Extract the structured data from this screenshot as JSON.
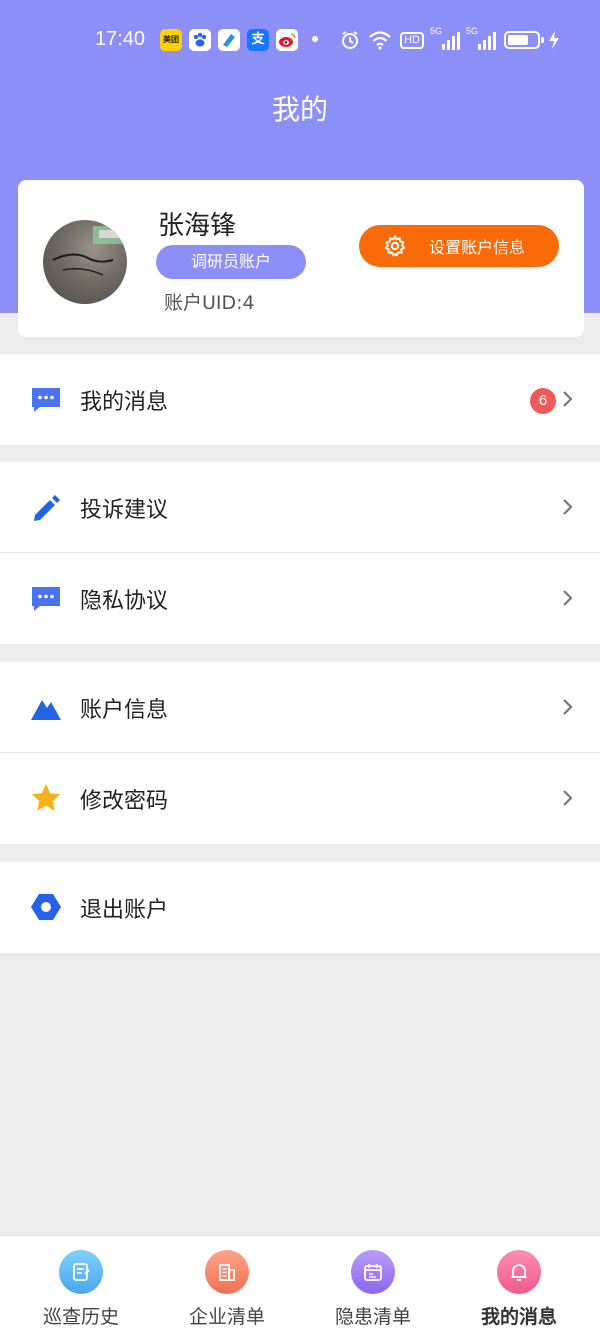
{
  "status_bar": {
    "time": "17:40",
    "app_icons": [
      "美团",
      "baidu-paw-icon",
      "app-icon",
      "支",
      "weibo-icon"
    ],
    "hd": "HD",
    "signal_1": "5G",
    "signal_2": "5G"
  },
  "header": {
    "title": "我的"
  },
  "profile": {
    "name": "张海锋",
    "role": "调研员账户",
    "uid": "账户UID:4",
    "settings_button": "设置账户信息"
  },
  "menu": [
    {
      "label": "我的消息",
      "icon": "message-icon",
      "badge": "6",
      "color": "#4a73f0"
    },
    {
      "label": "投诉建议",
      "icon": "pencil-icon",
      "color": "#2563e6"
    },
    {
      "label": "隐私协议",
      "icon": "message-icon",
      "color": "#4a73f0"
    },
    {
      "label": "账户信息",
      "icon": "mountain-icon",
      "color": "#2563e6"
    },
    {
      "label": "修改密码",
      "icon": "star-icon",
      "color": "#f6b21a"
    },
    {
      "label": "退出账户",
      "icon": "hexagon-icon",
      "color": "#2563e6"
    }
  ],
  "tabbar": [
    {
      "label": "巡查历史",
      "icon": "history-icon",
      "color": "#57b6f3"
    },
    {
      "label": "企业清单",
      "icon": "building-icon",
      "color": "#f2886a"
    },
    {
      "label": "隐患清单",
      "icon": "calendar-icon",
      "color": "#9a7bf0"
    },
    {
      "label": "我的消息",
      "icon": "bell-icon",
      "color": "#f56a9a",
      "active": true
    }
  ],
  "colors": {
    "header": "#8b8ff6",
    "accent_orange": "#f96a08",
    "badge_red": "#ee5a5a",
    "background": "#ececec"
  }
}
